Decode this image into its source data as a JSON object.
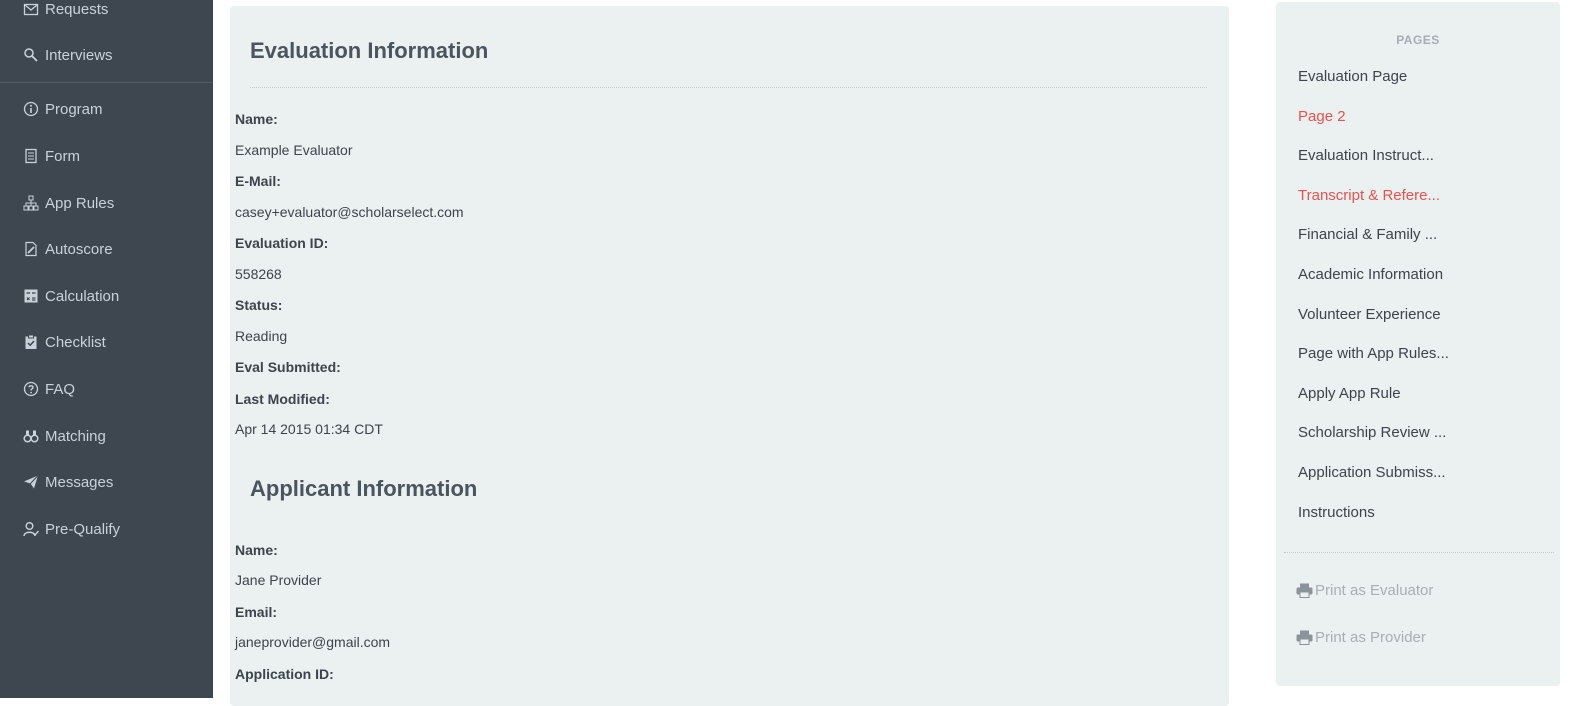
{
  "sidebar": {
    "items": [
      {
        "label": "Requests",
        "icon": "envelope-icon"
      },
      {
        "label": "Interviews",
        "icon": "search-users-icon"
      },
      {
        "label": "Program",
        "icon": "info-circle-icon"
      },
      {
        "label": "Form",
        "icon": "document-icon"
      },
      {
        "label": "App Rules",
        "icon": "sitemap-icon"
      },
      {
        "label": "Autoscore",
        "icon": "pencil-document-icon"
      },
      {
        "label": "Calculation",
        "icon": "calculator-icon"
      },
      {
        "label": "Checklist",
        "icon": "clipboard-check-icon"
      },
      {
        "label": "FAQ",
        "icon": "question-circle-icon"
      },
      {
        "label": "Matching",
        "icon": "binoculars-icon"
      },
      {
        "label": "Messages",
        "icon": "paper-plane-icon"
      },
      {
        "label": "Pre-Qualify",
        "icon": "user-check-icon"
      }
    ]
  },
  "evaluation": {
    "title": "Evaluation Information",
    "fields": [
      {
        "label": "Name:",
        "value": "Example Evaluator"
      },
      {
        "label": "E-Mail:",
        "value": "casey+evaluator@scholarselect.com"
      },
      {
        "label": "Evaluation ID:",
        "value": "558268"
      },
      {
        "label": "Status:",
        "value": "Reading"
      },
      {
        "label": "Eval Submitted:",
        "value": ""
      },
      {
        "label": "Last Modified:",
        "value": "Apr 14 2015 01:34 CDT"
      }
    ]
  },
  "applicant": {
    "title": "Applicant Information",
    "fields": [
      {
        "label": "Name:",
        "value": "Jane Provider"
      },
      {
        "label": "Email:",
        "value": "janeprovider@gmail.com"
      },
      {
        "label": "Application ID:",
        "value": ""
      }
    ]
  },
  "pages_panel": {
    "heading": "PAGES",
    "pages": [
      {
        "label": "Evaluation Page",
        "highlight": false
      },
      {
        "label": "Page 2",
        "highlight": true
      },
      {
        "label": "Evaluation Instruct...",
        "highlight": false
      },
      {
        "label": "Transcript & Refere...",
        "highlight": true
      },
      {
        "label": "Financial & Family ...",
        "highlight": false
      },
      {
        "label": "Academic Information",
        "highlight": false
      },
      {
        "label": "Volunteer Experience",
        "highlight": false
      },
      {
        "label": "Page with App Rules...",
        "highlight": false
      },
      {
        "label": "Apply App Rule",
        "highlight": false
      },
      {
        "label": "Scholarship Review ...",
        "highlight": false
      },
      {
        "label": "Application Submiss...",
        "highlight": false
      },
      {
        "label": "Instructions",
        "highlight": false
      }
    ],
    "print_evaluator": "Print as Evaluator",
    "print_provider": "Print as Provider"
  },
  "colors": {
    "sidebar_bg": "#3e4650",
    "panel_bg": "#ebf0f0",
    "highlight_red": "#e8524f"
  }
}
